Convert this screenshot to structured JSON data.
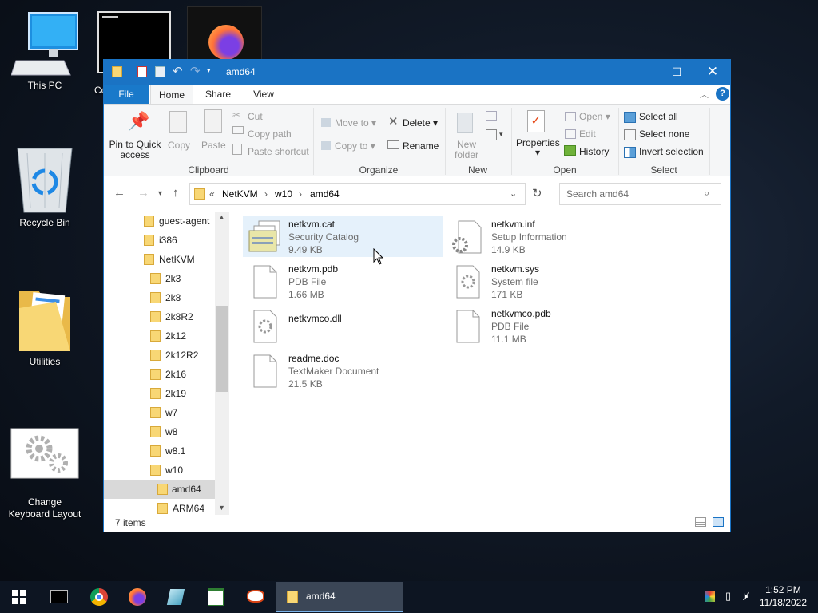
{
  "desktop": {
    "icons": [
      {
        "label": "This PC"
      },
      {
        "label": "Recycle Bin"
      },
      {
        "label": "Utilities"
      },
      {
        "label": "Change Keyboard Layout"
      },
      {
        "label": "Co"
      }
    ]
  },
  "window": {
    "title": "amd64",
    "tabs": {
      "file": "File",
      "home": "Home",
      "share": "Share",
      "view": "View"
    },
    "ribbon": {
      "clipboard": {
        "pin": "Pin to Quick access",
        "copy": "Copy",
        "paste": "Paste",
        "cut": "Cut",
        "copy_path": "Copy path",
        "paste_shortcut": "Paste shortcut",
        "group": "Clipboard"
      },
      "organize": {
        "move_to": "Move to",
        "copy_to": "Copy to",
        "delete": "Delete",
        "rename": "Rename",
        "group": "Organize"
      },
      "new": {
        "new_folder": "New folder",
        "group": "New"
      },
      "open": {
        "properties": "Properties",
        "open": "Open",
        "edit": "Edit",
        "history": "History",
        "group": "Open"
      },
      "select": {
        "select_all": "Select all",
        "select_none": "Select none",
        "invert": "Invert selection",
        "group": "Select"
      }
    },
    "address": {
      "prefix": "«",
      "crumbs": [
        "NetKVM",
        "w10",
        "amd64"
      ]
    },
    "search": {
      "placeholder": "Search amd64"
    },
    "tree": [
      {
        "label": "guest-agent"
      },
      {
        "label": "i386"
      },
      {
        "label": "NetKVM"
      },
      {
        "label": "2k3"
      },
      {
        "label": "2k8"
      },
      {
        "label": "2k8R2"
      },
      {
        "label": "2k12"
      },
      {
        "label": "2k12R2"
      },
      {
        "label": "2k16"
      },
      {
        "label": "2k19"
      },
      {
        "label": "w7"
      },
      {
        "label": "w8"
      },
      {
        "label": "w8.1"
      },
      {
        "label": "w10"
      },
      {
        "label": "amd64"
      },
      {
        "label": "ARM64"
      }
    ],
    "files": [
      {
        "name": "netkvm.cat",
        "type": "Security Catalog",
        "size": "9.49 KB"
      },
      {
        "name": "netkvm.inf",
        "type": "Setup Information",
        "size": "14.9 KB"
      },
      {
        "name": "netkvm.pdb",
        "type": "PDB File",
        "size": "1.66 MB"
      },
      {
        "name": "netkvm.sys",
        "type": "System file",
        "size": "171 KB"
      },
      {
        "name": "netkvmco.dll",
        "type": "",
        "size": ""
      },
      {
        "name": "netkvmco.pdb",
        "type": "PDB File",
        "size": "11.1 MB"
      },
      {
        "name": "readme.doc",
        "type": "TextMaker Document",
        "size": "21.5 KB"
      }
    ],
    "status": "7 items"
  },
  "taskbar": {
    "active_app": "amd64",
    "time": "1:52 PM",
    "date": "11/18/2022"
  },
  "colors": {
    "titlebar": "#1a73c4",
    "taskbar": "#0d1522",
    "folder": "#f8d775",
    "selection": "#e5f1fb"
  }
}
